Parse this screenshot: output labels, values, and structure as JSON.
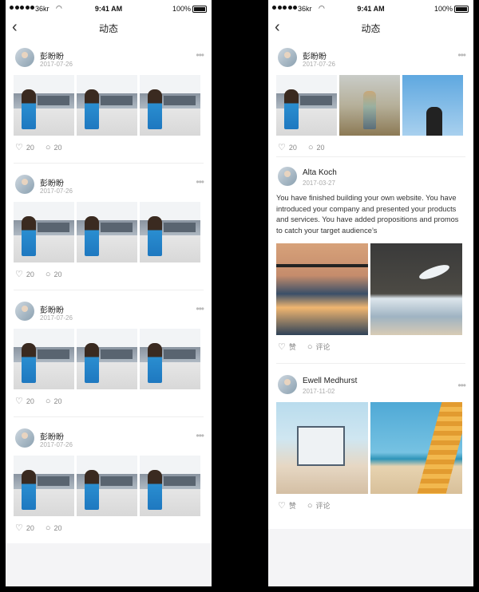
{
  "status_bar": {
    "carrier": "36kr",
    "time": "9:41 AM",
    "battery": "100%"
  },
  "nav": {
    "back_icon": "chevron-left-icon",
    "title": "动态"
  },
  "left_feed": [
    {
      "name": "彭盼盼",
      "date": "2017-07-26",
      "likes": "20",
      "comments": "20",
      "photos": [
        "building",
        "building",
        "building"
      ]
    },
    {
      "name": "彭盼盼",
      "date": "2017-07-26",
      "likes": "20",
      "comments": "20",
      "photos": [
        "building",
        "building",
        "building"
      ]
    },
    {
      "name": "彭盼盼",
      "date": "2017-07-26",
      "likes": "20",
      "comments": "20",
      "photos": [
        "building",
        "building",
        "building"
      ]
    },
    {
      "name": "彭盼盼",
      "date": "2017-07-26",
      "likes": "20",
      "comments": "20",
      "photos": [
        "building",
        "building",
        "building"
      ]
    }
  ],
  "right_feed": [
    {
      "name": "彭盼盼",
      "date": "2017-07-26",
      "likes": "20",
      "comments": "20",
      "photos": [
        "building",
        "field",
        "sky"
      ]
    },
    {
      "name": "Alta Koch",
      "date": "2017-03-27",
      "text": "You have finished building your own website. You have introduced your company and presented your products and services. You have added propositions and promos to catch your target audience’s",
      "like_label": "赞",
      "comment_label": "评论",
      "photos": [
        "sunset",
        "pier"
      ]
    },
    {
      "name": "Ewell Medhurst",
      "date": "2017-11-02",
      "like_label": "赞",
      "comment_label": "评论",
      "photos": [
        "lifeguard",
        "beach"
      ]
    }
  ],
  "icons": {
    "like": "heart-icon",
    "comment": "comment-icon",
    "more": "more-icon"
  }
}
